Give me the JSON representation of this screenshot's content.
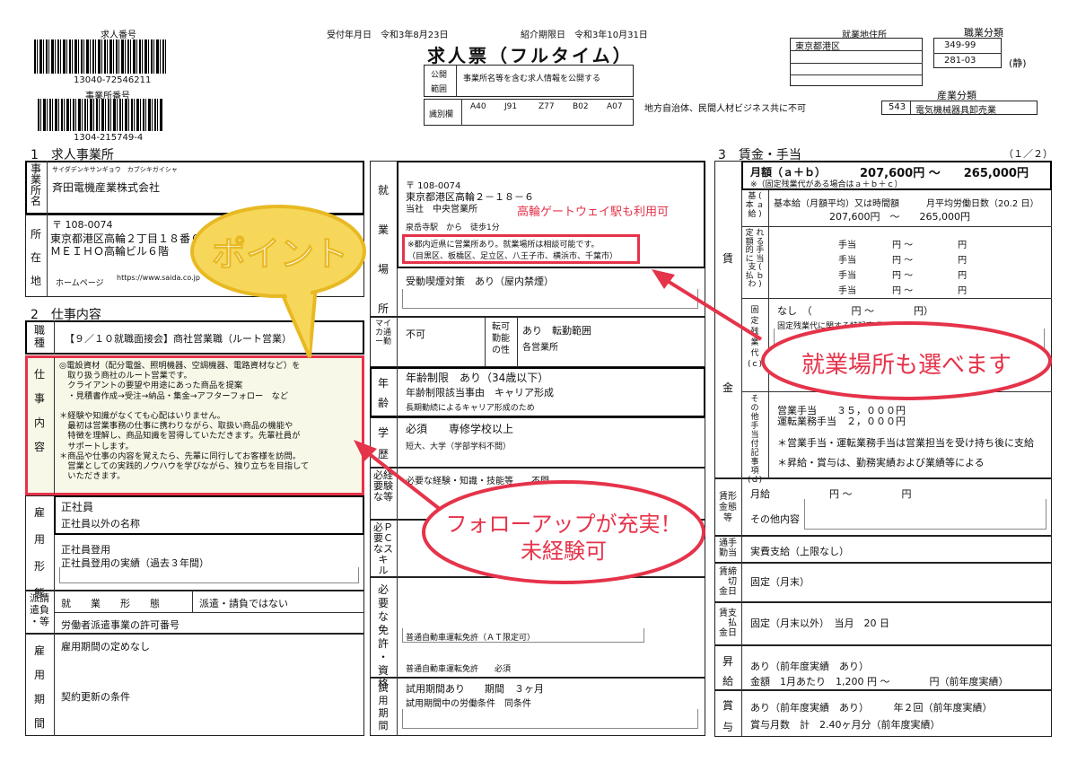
{
  "header": {
    "job_number_label": "求人番号",
    "job_number": "13040-72546211",
    "office_number_label": "事業所番号",
    "office_number": "1304-215749-4",
    "reception_date": "受付年月日　令和3年8月23日",
    "referral_deadline": "紹介期限日　令和3年10月31日",
    "title": "求人票（フルタイム）",
    "publish_label_1": "公開",
    "publish_label_2": "範囲",
    "publish_value": "事業所名等を含む求人情報を公開する",
    "id_label": "識別欄",
    "id_codes": [
      "A40",
      "J91",
      "Z77",
      "B02",
      "A07"
    ],
    "partner_note": "地方自治体、民間人材ビジネス共に不可",
    "work_address_label": "就業地住所",
    "work_address": "東京都港区",
    "job_class_label": "職業分類",
    "job_class_1": "349-99",
    "job_class_2": "281-03",
    "job_class_mark": "(静)",
    "industry_label": "産業分類",
    "industry_code": "543",
    "industry_name": "電気機械器具卸売業"
  },
  "section1": {
    "title": "1　求人事業所",
    "name_label": "事業所名",
    "name_kana": "サイダデンキサンギョウ　カブシキガイシャ",
    "name": "斉田電機産業株式会社",
    "addr_label": "所在地",
    "zip": "〒 108-0074",
    "addr_1": "東京都港区高輪２丁目１８番６号",
    "addr_2": "ＭＥＩＨＯ高輪ビル６階",
    "homepage_label": "ホームページ",
    "homepage": "https://www.saida.co.jp"
  },
  "section2": {
    "title": "2　仕事内容",
    "occupation_label": "職種",
    "occupation": "【９／１０就職面接会】商社営業職（ルート営業）",
    "job_label": "仕事内容",
    "job_text": "◎電設資材（配分電盤、照明機器、空調機器、電路資材など）を\n　取り扱う商社のルート営業です。\n　クライアントの要望や用途にあった商品を提案\n　・見積書作成→受注→納品・集金→アフターフォロー　など\n\n＊経験や知識がなくても心配はいりません。\n　最初は営業事務の仕事に携わりながら、取扱い商品の機能や\n　特徴を理解し、商品知識を習得していただきます。先輩社員が\n　サポートします。\n＊商品や仕事の内容を覚えたら、先輩に同行してお客様を訪問。\n　営業としての実践的ノウハウを学びながら、独り立ちを目指して\n　いただきます。",
    "employ_label": "雇用形態",
    "employ_type": "正社員",
    "employ_other_name": "正社員以外の名称",
    "hire_label": "正社員登用",
    "hire_record": "正社員登用の実績（過去３年間）",
    "dispatch_label": "派請遣負・等",
    "dispatch_form": "就　　業　　形　　態",
    "dispatch_value": "派遣・請負ではない",
    "dispatch_license": "労働者派遣事業の許可番号",
    "period_label": "雇用期間",
    "period_value": "雇用期間の定めなし",
    "renewal": "契約更新の条件"
  },
  "workplace": {
    "label": "就業場所",
    "zip": "〒 108-0074",
    "addr": "東京都港区高輪２－１８－６",
    "office": "当社　中央営業所",
    "station": "泉岳寺駅　から　徒歩1分",
    "note_1": "※都内近県に営業所あり。就業場所は相談可能です。",
    "note_2": "（目黒区、板橋区、足立区、八王子市、横浜市、千葉市）",
    "smoking": "受動喫煙対策　あり（屋内禁煙）"
  },
  "commute": {
    "label": "マイカー通勤",
    "value": "不可",
    "transfer_label": "転勤可能性",
    "transfer_value": "あり　転勤範囲",
    "transfer_range": "各営業所"
  },
  "age": {
    "label": "年齢",
    "limit": "年齢制限　あり（34歳以下）",
    "reason_label": "年齢制限該当事由　キャリア形成",
    "reason": "長期勤続によるキャリア形成のため"
  },
  "education": {
    "label": "学歴",
    "value": "必須　　専修学校以上",
    "detail": "短大、大学（学部学科不問）"
  },
  "experience": {
    "label": "必要な経験等",
    "value": "必要な経験・知識・技能等　　不問"
  },
  "pc_skill": {
    "label": "必要なPCスキル"
  },
  "license": {
    "label": "必要な免許・資格",
    "detail": "普通自動車運転免許（ＡＴ限定可）",
    "value": "普通自動車運転免許　　必須"
  },
  "trial": {
    "label": "試用期間",
    "value": "試用期間あり　　期間　３ヶ月",
    "condition": "試用期間中の労働条件　同条件"
  },
  "section3": {
    "title": "3　賃金・手当",
    "page": "（１／２）",
    "monthly_label": "月額（ａ＋ｂ）",
    "monthly_value": "207,600円 〜　　265,000円",
    "monthly_note": "※（固定残業代がある場合はａ＋ｂ＋ｃ）",
    "wage_label": "賃",
    "money_label": "金",
    "base_label": "基本給(ａ)",
    "base_title": "基本給（月額平均）又は時間額　　　月平均労働日数（20.2 日）",
    "base_value": "207,600円　〜　　265,000円",
    "allow_label": "定額的に支払われる手当(ｂ)",
    "allow_rows": [
      "手当　　　　円 〜　　　　　円",
      "手当　　　　円 〜　　　　　円",
      "手当　　　　円 〜　　　　　円",
      "手当　　　　円 〜　　　　　円"
    ],
    "fixed_label": "固定残業代(ｃ)",
    "fixed_value": "なし　（　　　　円 〜　　　　円）",
    "fixed_note": "固定残業代に関する特記事項",
    "other_label": "その他手当付記事項(ｄ)",
    "other_1": "営業手当　　３５，０００円",
    "other_2": "運転業務手当　２，０００円",
    "other_3": "＊営業手当・運転業務手当は営業担当を受け持ち後に支給",
    "other_4": "＊昇給・賞与は、勤務実績および業績等による",
    "form_label": "賃金形態等",
    "form_monthly": "月給　　　　　　円 〜　　　　　円",
    "form_other": "その他内容",
    "commute_label": "通勤手当",
    "commute_value": "実費支給（上限なし）",
    "close_label": "賃金締切日",
    "close_value": "固定（月末）",
    "pay_label": "賃金支払日",
    "pay_value": "固定（月末以外）　当月　20 日",
    "raise_label": "昇給",
    "raise_1": "あり（前年度実績　あり）",
    "raise_2": "金額　1月あたり　1,200 円 〜　　　　円（前年度実績）",
    "bonus_label": "賞与",
    "bonus_1": "あり（前年度実績　あり）　　　年２回（前年度実績）",
    "bonus_2": "賞与月数　計　2.40ヶ月分（前年度実績）"
  },
  "annotations": {
    "point": "ポイント",
    "station_note": "高輪ゲートウェイ駅も利用可",
    "select_place": "就業場所も選べます",
    "follow_1": "フォローアップが充実！",
    "follow_2": "未経験可"
  },
  "colors": {
    "accent": "#e5334a",
    "point_fill": "#f6d75a",
    "point_stroke": "#e8b923",
    "highlight_fill": "#f8f8e8"
  }
}
